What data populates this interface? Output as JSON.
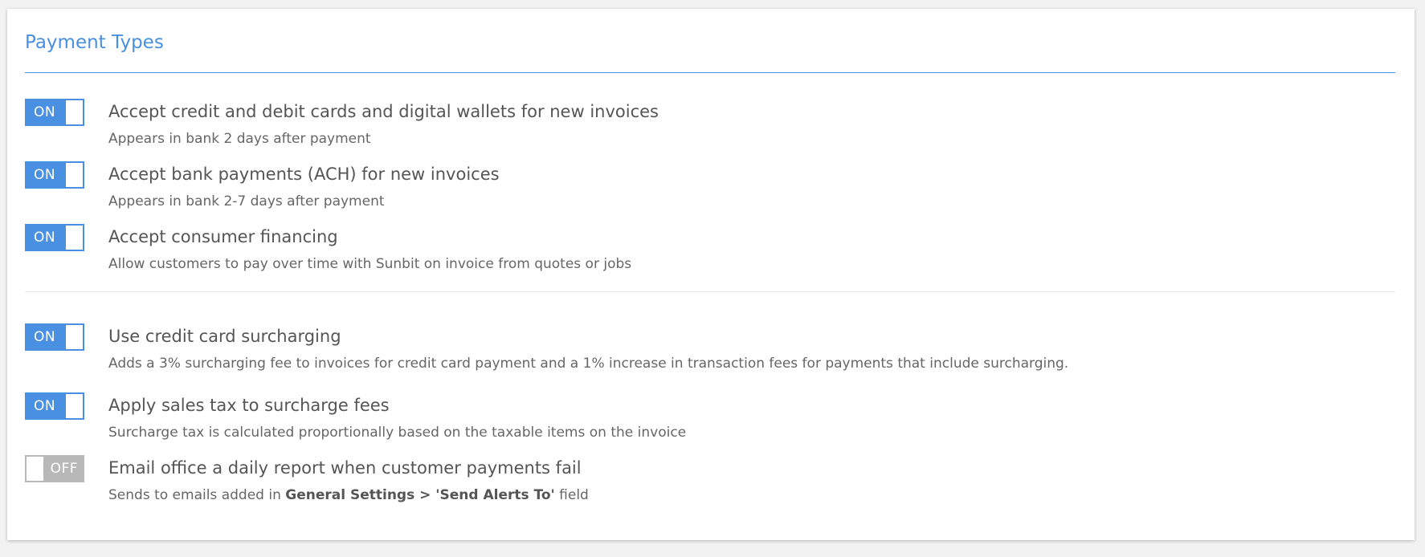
{
  "section": {
    "title": "Payment Types"
  },
  "settings": [
    {
      "toggle_label": "ON",
      "state": "on",
      "title": "Accept credit and debit cards and digital wallets for new invoices",
      "description": "Appears in bank 2 days after payment"
    },
    {
      "toggle_label": "ON",
      "state": "on",
      "title": "Accept bank payments (ACH) for new invoices",
      "description": "Appears in bank 2-7 days after payment"
    },
    {
      "toggle_label": "ON",
      "state": "on",
      "title": "Accept consumer financing",
      "description": "Allow customers to pay over time with Sunbit on invoice from quotes or jobs"
    },
    {
      "toggle_label": "ON",
      "state": "on",
      "title": "Use credit card surcharging",
      "description": "Adds a 3% surcharging fee to invoices for credit card payment and a 1% increase in transaction fees for payments that include surcharging."
    },
    {
      "toggle_label": "ON",
      "state": "on",
      "title": "Apply sales tax to surcharge fees",
      "description": "Surcharge tax is calculated proportionally based on the taxable items on the invoice"
    },
    {
      "toggle_label": "OFF",
      "state": "off",
      "title": "Email office a daily report when customer payments fail",
      "description_prefix": "Sends to emails added in ",
      "description_bold": "General Settings > 'Send Alerts To'",
      "description_suffix": " field"
    }
  ],
  "colors": {
    "accent": "#4a90e2",
    "toggle_off": "#b8b8b8",
    "text_primary": "#555555",
    "text_secondary": "#666666"
  }
}
